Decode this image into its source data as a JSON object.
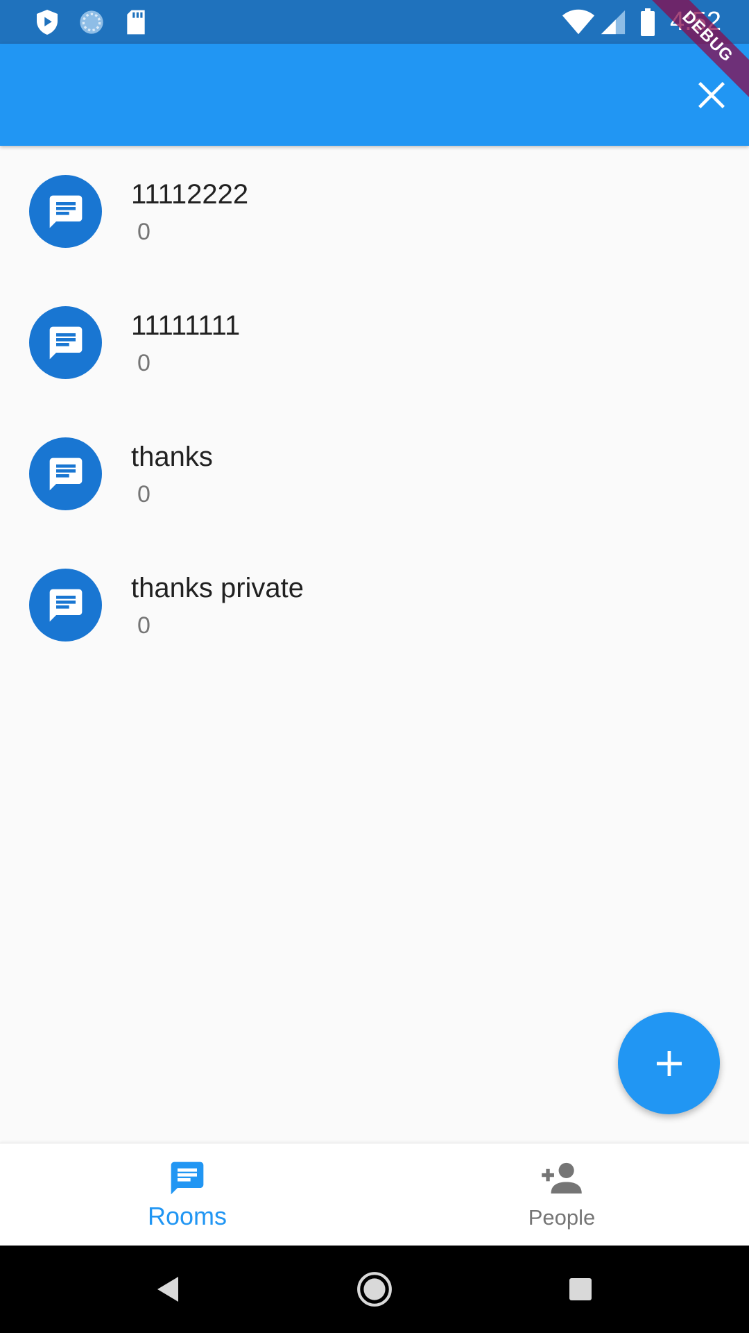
{
  "status_bar": {
    "time": "4:52",
    "icons": [
      "shield-icon",
      "sync-icon",
      "sd-card-icon",
      "wifi-icon",
      "cell-signal-icon",
      "battery-icon"
    ]
  },
  "debug_banner": {
    "label": "DEBUG"
  },
  "app_bar": {
    "close_icon": "close-icon"
  },
  "rooms": [
    {
      "title": "11112222",
      "subtitle": "0",
      "icon": "chat-icon"
    },
    {
      "title": "11111111",
      "subtitle": "0",
      "icon": "chat-icon"
    },
    {
      "title": "thanks",
      "subtitle": "0",
      "icon": "chat-icon"
    },
    {
      "title": "thanks private",
      "subtitle": "0",
      "icon": "chat-icon"
    }
  ],
  "fab": {
    "icon": "plus-icon"
  },
  "bottom_nav": {
    "items": [
      {
        "label": "Rooms",
        "icon": "chat-icon",
        "selected": true
      },
      {
        "label": "People",
        "icon": "person-add-icon",
        "selected": false
      }
    ]
  },
  "colors": {
    "primary": "#2196f3",
    "status_bar": "#1f72bd",
    "avatar": "#1976d2",
    "inactive": "#757575"
  }
}
